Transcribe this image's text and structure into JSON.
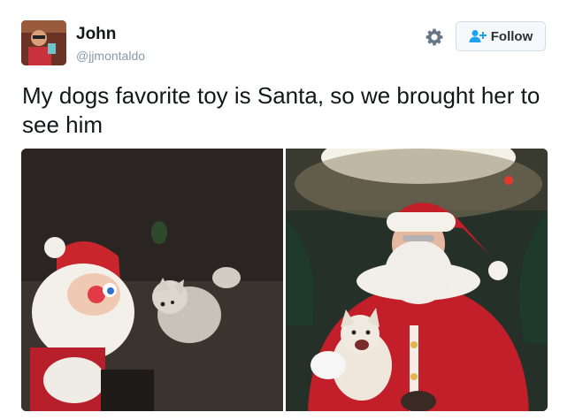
{
  "user": {
    "display_name": "John",
    "handle": "@jjmontaldo",
    "avatar_alt": "profile photo"
  },
  "actions": {
    "settings_icon": "gear-icon",
    "follow_label": "Follow",
    "follow_icon": "add-user-icon"
  },
  "tweet": {
    "text": "My dogs favorite toy is Santa, so we brought her to see him"
  },
  "media": {
    "photos": [
      {
        "id": "left",
        "subject": "plush santa toy and white dog on dark carpet"
      },
      {
        "id": "right",
        "subject": "santa claus holding a white dog"
      }
    ]
  },
  "colors": {
    "follow_blue": "#1da1f2",
    "handle_gray": "#8899a6",
    "text": "#14171a"
  }
}
